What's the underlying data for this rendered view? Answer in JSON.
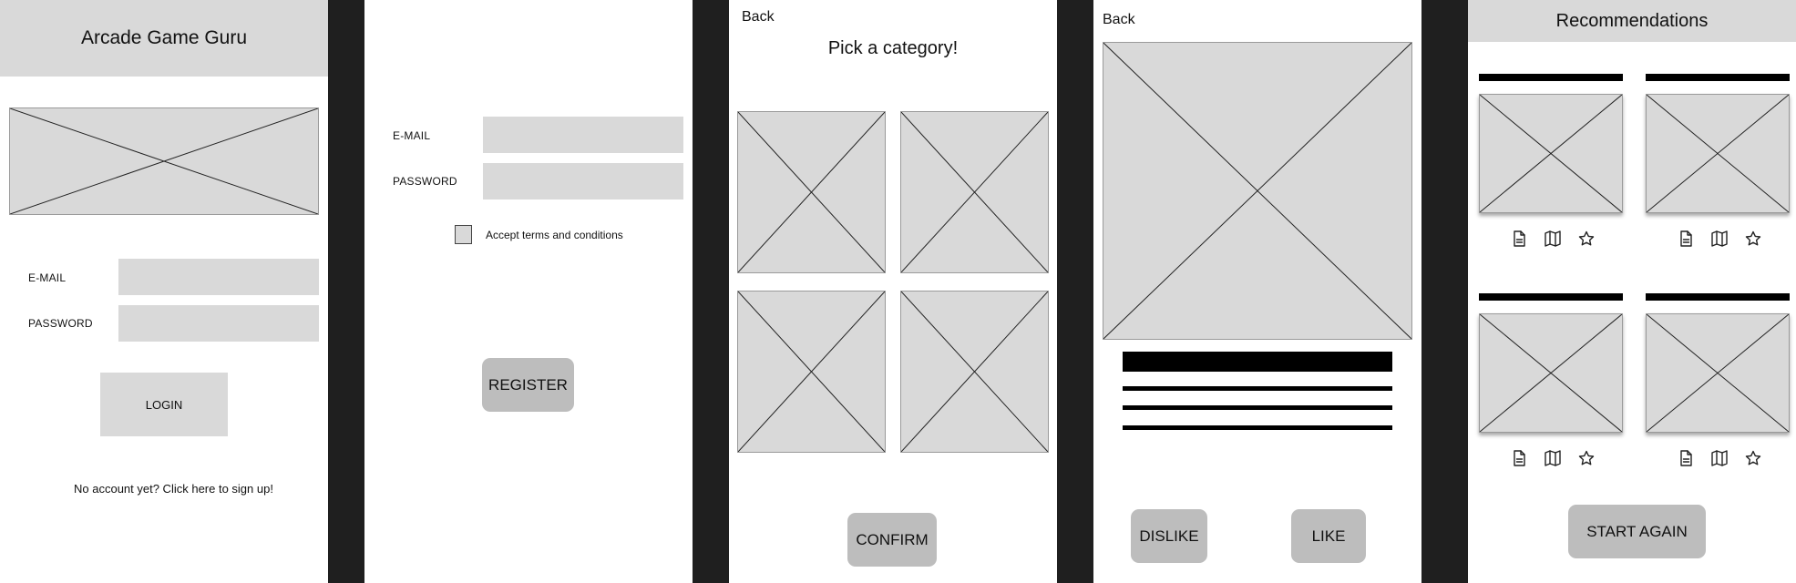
{
  "login": {
    "title": "Arcade Game Guru",
    "email_label": "E-MAIL",
    "password_label": "PASSWORD",
    "login_button": "LOGIN",
    "signup_link": "No account yet? Click here to sign up!"
  },
  "register": {
    "email_label": "E-MAIL",
    "password_label": "PASSWORD",
    "terms_label": "Accept terms and conditions",
    "register_button": "REGISTER"
  },
  "category": {
    "back": "Back",
    "title": "Pick a category!",
    "confirm_button": "CONFIRM"
  },
  "detail": {
    "back": "Back",
    "dislike_button": "DISLIKE",
    "like_button": "LIKE"
  },
  "recommendations": {
    "title": "Recommendations",
    "card_icons": [
      "document-icon",
      "map-icon",
      "star-icon"
    ],
    "start_again_button": "START AGAIN"
  }
}
